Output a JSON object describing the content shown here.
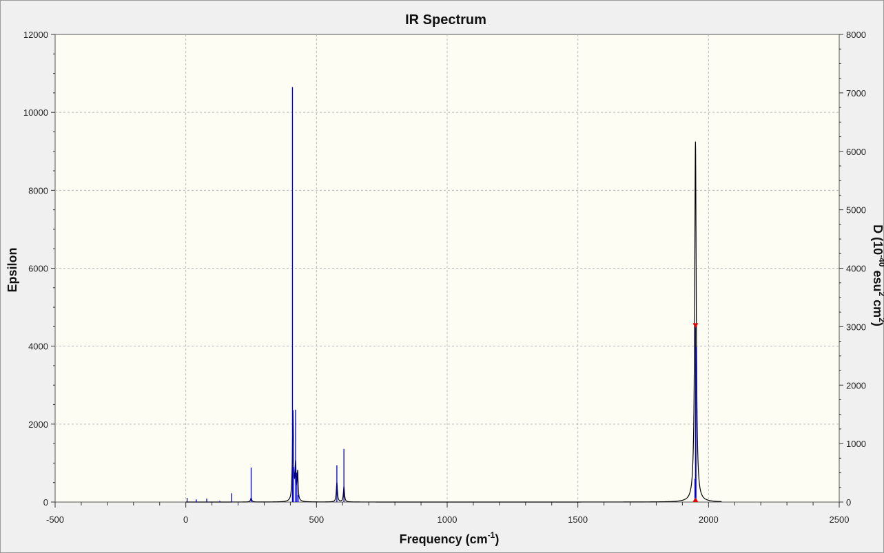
{
  "chart_data": {
    "type": "line",
    "title": "IR Spectrum",
    "xlabel": "Frequency (cm",
    "xlabel_sup": "-1",
    "xlabel_close": ")",
    "ylabel": "Epsilon",
    "y2label_parts": [
      "D (10",
      "-40",
      " esu",
      "2",
      " cm",
      "2",
      ")"
    ],
    "xlim": [
      -500,
      2500
    ],
    "ylim": [
      0,
      12000
    ],
    "y2lim": [
      0,
      8000
    ],
    "x_ticks": [
      -500,
      0,
      500,
      1000,
      1500,
      2000,
      2500
    ],
    "x_minor_step": 100,
    "y_ticks": [
      0,
      2000,
      4000,
      6000,
      8000,
      10000,
      12000
    ],
    "y2_ticks": [
      0,
      1000,
      2000,
      3000,
      4000,
      5000,
      6000,
      7000,
      8000
    ],
    "grid": true,
    "colors": {
      "spectrum": "#000000",
      "sticks": "#0000c8",
      "marker": "#e00000",
      "plot_bg": "#fdfdf4",
      "grid": "#b8b8b8"
    },
    "series": [
      {
        "kind": "spectrum_curve",
        "peaks": [
          {
            "x": 250,
            "h": 100,
            "w": 6
          },
          {
            "x": 410,
            "h": 2300,
            "w": 5
          },
          {
            "x": 420,
            "h": 900,
            "w": 5
          },
          {
            "x": 428,
            "h": 700,
            "w": 4
          },
          {
            "x": 578,
            "h": 500,
            "w": 5
          },
          {
            "x": 605,
            "h": 400,
            "w": 5
          },
          {
            "x": 1950,
            "h": 9250,
            "w": 7
          }
        ],
        "x_range": [
          0,
          2050
        ]
      },
      {
        "kind": "sticks",
        "x": [
          5,
          40,
          80,
          130,
          175,
          250,
          408,
          412,
          420,
          425,
          430,
          578,
          605,
          1948,
          1950,
          1952
        ],
        "y2": [
          70,
          45,
          60,
          20,
          150,
          590,
          7100,
          600,
          1580,
          500,
          120,
          630,
          910,
          400,
          3000,
          2650
        ]
      }
    ],
    "marker": {
      "x": 1950,
      "y2": 3000
    }
  }
}
